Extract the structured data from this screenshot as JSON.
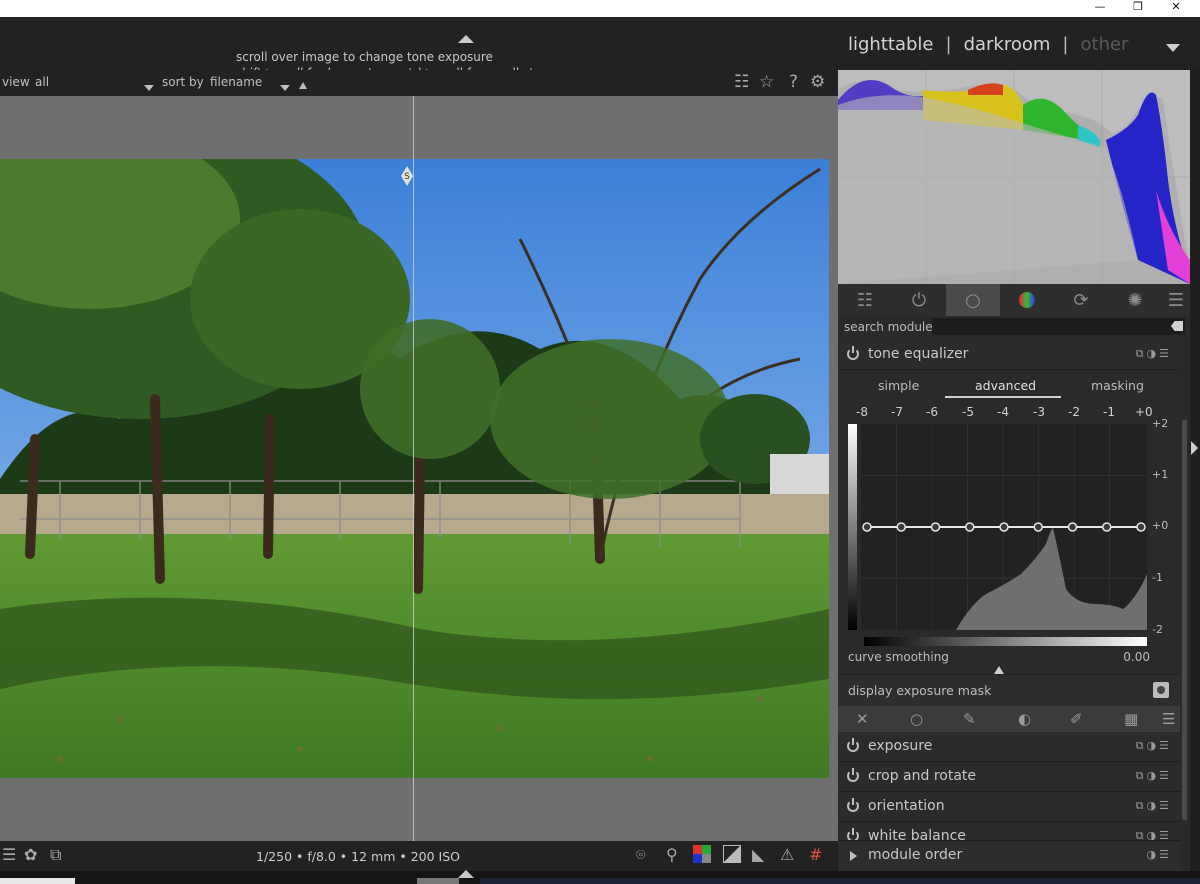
{
  "window": {
    "minimize": "—",
    "restore": "❐",
    "close": "✕"
  },
  "header": {
    "hint_line1": "scroll over image to change tone exposure",
    "hint_line2": "shift+scroll for large steps; ctrl+scroll for small steps",
    "views": {
      "lighttable": "lighttable",
      "sep1": "|",
      "darkroom": "darkroom",
      "sep2": "|",
      "other": "other"
    }
  },
  "filterbar": {
    "view_label": "view",
    "view_value": "all",
    "sort_label": "sort by",
    "sort_value": "filename"
  },
  "toolbar_icons": {
    "styles": "☷",
    "star": "☆",
    "help": "?",
    "settings": "⚙"
  },
  "bottombar": {
    "exif": "1/250 • f/8.0 • 12 mm • 200 ISO"
  },
  "right_panel": {
    "search_label": "search module",
    "search_value": "",
    "tone_equalizer": {
      "title": "tone equalizer",
      "tabs": [
        "simple",
        "advanced",
        "masking"
      ],
      "active_tab": "advanced",
      "ev_labels": [
        "-8",
        "-7",
        "-6",
        "-5",
        "-4",
        "-3",
        "-2",
        "-1",
        "+0"
      ],
      "right_labels": [
        "+2",
        "+1",
        "+0",
        "-1",
        "-2"
      ],
      "curve_values": [
        0,
        0,
        0,
        0,
        0,
        0,
        0,
        0,
        0
      ],
      "curve_smoothing_label": "curve smoothing",
      "curve_smoothing_value": "0.00",
      "display_mask_label": "display exposure mask"
    },
    "modules": [
      {
        "title": "exposure"
      },
      {
        "title": "crop and rotate"
      },
      {
        "title": "orientation"
      },
      {
        "title": "white balance"
      }
    ],
    "module_order": "module order"
  },
  "colors": {
    "accent": "#cfcfcf",
    "panel_bg": "#2a2a2a",
    "center_bg": "#6f6f6f"
  }
}
